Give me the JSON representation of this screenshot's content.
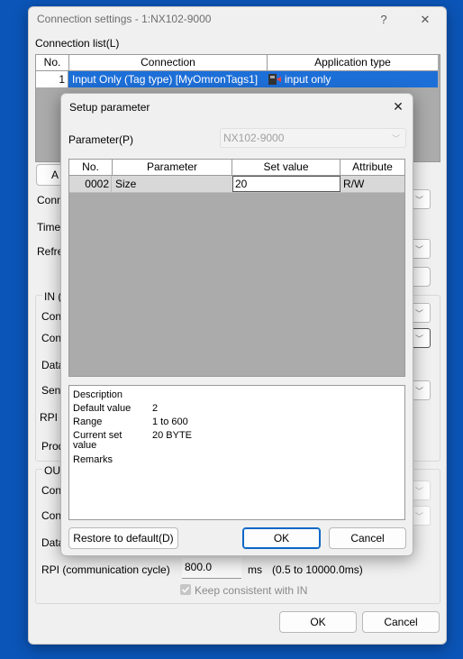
{
  "main_window": {
    "title": "Connection settings  - 1:NX102-9000",
    "help_icon": "?",
    "close_icon": "✕",
    "connection_list_label": "Connection list(L)",
    "table": {
      "headers": [
        "No.",
        "Connection",
        "Application type"
      ],
      "row": {
        "no": "1",
        "connection": "Input Only (Tag type) [MyOmronTags1]",
        "app_type": "input only"
      }
    },
    "partial_labels": {
      "add_btn": "A",
      "conn": "Conn",
      "time": "Time",
      "refre": "Refre",
      "in_group": "IN (i",
      "in_con1": "Con",
      "in_con2": "Con",
      "in_data": "Data",
      "in_sen": "Sen",
      "in_rpi": "RPI (",
      "in_prod": "Prod",
      "out_group": "OUT",
      "out_con1": "Con",
      "out_con2": "Con",
      "out_data": "Data"
    },
    "rpi_label": "RPI (communication cycle)",
    "rpi_value": "800.0",
    "rpi_unit": "ms",
    "rpi_range": "(0.5 to 10000.0ms)",
    "keep_consistent": "Keep consistent with IN",
    "ok": "OK",
    "cancel": "Cancel"
  },
  "dialog": {
    "title": "Setup parameter",
    "close_icon": "✕",
    "parameter_label": "Parameter(P)",
    "parameter_value": "NX102-9000",
    "headers": [
      "No.",
      "Parameter",
      "Set value",
      "Attribute"
    ],
    "row": {
      "no": "0002",
      "parameter": "Size",
      "set_value": "20",
      "attribute": "R/W"
    },
    "description": {
      "title": "Description",
      "default_label": "Default value",
      "default_value": "2",
      "range_label": "Range",
      "range_value": "1 to 600",
      "current_label_1": "Current set",
      "current_label_2": "value",
      "current_value": "20 BYTE",
      "remarks_label": "Remarks"
    },
    "restore": "Restore to default(D)",
    "ok": "OK",
    "cancel": "Cancel"
  },
  "colors": {
    "accent": "#0b67c6",
    "desktop": "#0b55b8",
    "selected_row": "#1d6fd8"
  }
}
